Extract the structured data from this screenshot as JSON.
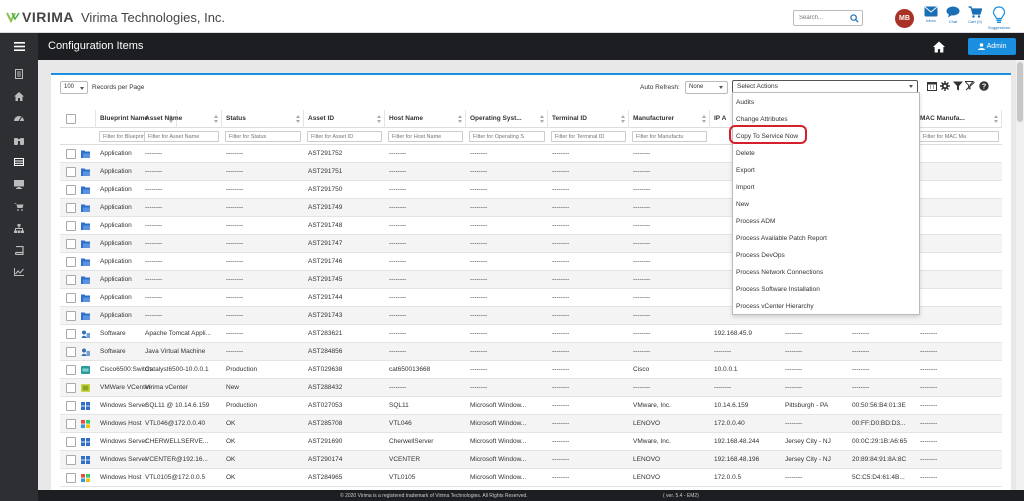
{
  "app": {
    "logo_text": "VIRIMA",
    "company": "Virima Technologies, Inc.",
    "search_placeholder": "Search...",
    "avatar_initials": "MB",
    "top_icons": [
      {
        "label": "Inbox",
        "icon": "mail-icon"
      },
      {
        "label": "Chat",
        "icon": "chat-icon"
      },
      {
        "label": "Cart (0)",
        "icon": "cart-icon"
      },
      {
        "label": "Suggestions",
        "icon": "lightbulb-icon"
      }
    ],
    "colors": {
      "accent": "#1a8fe0",
      "dark": "#1c1e22",
      "avatar": "#a93226",
      "highlight": "#d4202a"
    }
  },
  "header": {
    "title": "Configuration Items",
    "admin_label": "Admin"
  },
  "toolbar": {
    "records_per_page": "100",
    "records_label": "Records per Page",
    "auto_refresh_label": "Auto Refresh:",
    "auto_refresh_value": "None",
    "actions_placeholder": "Select Actions"
  },
  "columns": [
    {
      "label": "Blueprint Name",
      "filter": "Filter for Blueprint Nam"
    },
    {
      "label": "Asset Name",
      "filter": "Filter for Asset Name"
    },
    {
      "label": "Status",
      "filter": "Filter for Status"
    },
    {
      "label": "Asset ID",
      "filter": "Filter for Asset ID"
    },
    {
      "label": "Host Name",
      "filter": "Filter for Host Name"
    },
    {
      "label": "Operating Syst...",
      "filter": "Filter for Operating S"
    },
    {
      "label": "Terminal ID",
      "filter": "Filter for Terminal ID"
    },
    {
      "label": "Manufacturer",
      "filter": "Filter for Manufactu"
    },
    {
      "label": "IP A",
      "filter": ""
    },
    {
      "label": "",
      "filter": ""
    },
    {
      "label": "",
      "filter": ""
    },
    {
      "label": "MAC Manufa...",
      "filter": "Filter for MAC Ma"
    }
  ],
  "rows": [
    {
      "icon": "folder-icon",
      "cells": [
        "Application",
        "--------",
        "--------",
        "AST291752",
        "--------",
        "--------",
        "--------",
        "--------",
        "",
        "",
        "",
        ""
      ]
    },
    {
      "icon": "folder-icon",
      "cells": [
        "Application",
        "--------",
        "--------",
        "AST291751",
        "--------",
        "--------",
        "--------",
        "--------",
        "",
        "",
        "",
        ""
      ]
    },
    {
      "icon": "folder-icon",
      "cells": [
        "Application",
        "--------",
        "--------",
        "AST291750",
        "--------",
        "--------",
        "--------",
        "--------",
        "",
        "",
        "",
        ""
      ]
    },
    {
      "icon": "folder-icon",
      "cells": [
        "Application",
        "--------",
        "--------",
        "AST291749",
        "--------",
        "--------",
        "--------",
        "--------",
        "",
        "",
        "",
        ""
      ]
    },
    {
      "icon": "folder-icon",
      "cells": [
        "Application",
        "--------",
        "--------",
        "AST291748",
        "--------",
        "--------",
        "--------",
        "--------",
        "",
        "",
        "",
        ""
      ]
    },
    {
      "icon": "folder-icon",
      "cells": [
        "Application",
        "--------",
        "--------",
        "AST291747",
        "--------",
        "--------",
        "--------",
        "--------",
        "",
        "",
        "",
        ""
      ]
    },
    {
      "icon": "folder-icon",
      "cells": [
        "Application",
        "--------",
        "--------",
        "AST291746",
        "--------",
        "--------",
        "--------",
        "--------",
        "",
        "",
        "",
        ""
      ]
    },
    {
      "icon": "folder-icon",
      "cells": [
        "Application",
        "--------",
        "--------",
        "AST291745",
        "--------",
        "--------",
        "--------",
        "--------",
        "",
        "",
        "",
        ""
      ]
    },
    {
      "icon": "folder-icon",
      "cells": [
        "Application",
        "--------",
        "--------",
        "AST291744",
        "--------",
        "--------",
        "--------",
        "--------",
        "",
        "",
        "",
        ""
      ]
    },
    {
      "icon": "folder-icon",
      "cells": [
        "Application",
        "--------",
        "--------",
        "AST291743",
        "--------",
        "--------",
        "--------",
        "--------",
        "",
        "",
        "",
        ""
      ]
    },
    {
      "icon": "software-icon",
      "cells": [
        "Software",
        "Apache Tomcat Appli...",
        "--------",
        "AST283621",
        "--------",
        "--------",
        "--------",
        "--------",
        "192.168.45.9",
        "--------",
        "--------",
        "--------"
      ]
    },
    {
      "icon": "software-icon",
      "cells": [
        "Software",
        "Java Virtual Machine",
        "--------",
        "AST284856",
        "--------",
        "--------",
        "--------",
        "--------",
        "--------",
        "--------",
        "--------",
        "--------"
      ]
    },
    {
      "icon": "switch-icon",
      "cells": [
        "Cisco6500:Switch",
        "Catalyst6500-10.0.0.1",
        "Production",
        "AST029638",
        "cat650013668",
        "--------",
        "--------",
        "Cisco",
        "10.0.0.1",
        "--------",
        "--------",
        "--------"
      ]
    },
    {
      "icon": "vcenter-icon",
      "cells": [
        "VMWare VCenter",
        "Virima vCenter",
        "New",
        "AST288432",
        "--------",
        "--------",
        "--------",
        "--------",
        "--------",
        "--------",
        "--------",
        "--------"
      ]
    },
    {
      "icon": "windows-icon",
      "cells": [
        "Windows Server",
        "SQL11 @ 10.14.6.159",
        "Production",
        "AST027053",
        "SQL11",
        "Microsoft Window...",
        "--------",
        "VMware, Inc.",
        "10.14.6.159",
        "Pittsburgh - PA",
        "00:50:56:B4:01:3E",
        "--------"
      ]
    },
    {
      "icon": "windows-color-icon",
      "cells": [
        "Windows Host",
        "VTL046@172.0.0.40",
        "OK",
        "AST285708",
        "VTL046",
        "Microsoft Window...",
        "--------",
        "LENOVO",
        "172.0.0.40",
        "--------",
        "00:FF:D0:BD:D3...",
        "--------"
      ]
    },
    {
      "icon": "windows-icon",
      "cells": [
        "Windows Server",
        "CHERWELLSERVE...",
        "OK",
        "AST291690",
        "CherwellServer",
        "Microsoft Window...",
        "--------",
        "VMware, Inc.",
        "192.168.48.244",
        "Jersey City - NJ",
        "00:0C:29:1B:A6:65",
        "--------"
      ]
    },
    {
      "icon": "windows-icon",
      "cells": [
        "Windows Server",
        "VCENTER@192.16...",
        "OK",
        "AST290174",
        "VCENTER",
        "Microsoft Window...",
        "--------",
        "LENOVO",
        "192.168.48.196",
        "Jersey City - NJ",
        "20:89:84:91:8A:8C",
        "--------"
      ]
    },
    {
      "icon": "windows-color-icon",
      "cells": [
        "Windows Host",
        "VTL0105@172.0.0.5",
        "OK",
        "AST284965",
        "VTL0105",
        "Microsoft Window...",
        "--------",
        "LENOVO",
        "172.0.0.5",
        "--------",
        "5C:C5:D4:61:4B...",
        "--------"
      ]
    }
  ],
  "actions_menu": [
    "Audits",
    "Change Attributes",
    "Copy To Service Now",
    "Delete",
    "Export",
    "Import",
    "New",
    "Process ADM",
    "Process Available Patch Report",
    "Process DevOps",
    "Process Network Connections",
    "Process Software Installation",
    "Process vCenter Hierarchy"
  ],
  "footer": {
    "copyright": "© 2020 Virima is a registered trademark of Virima Technologies. All Rights Reserved.",
    "version": "( ver. 5.4 - EM2)"
  }
}
